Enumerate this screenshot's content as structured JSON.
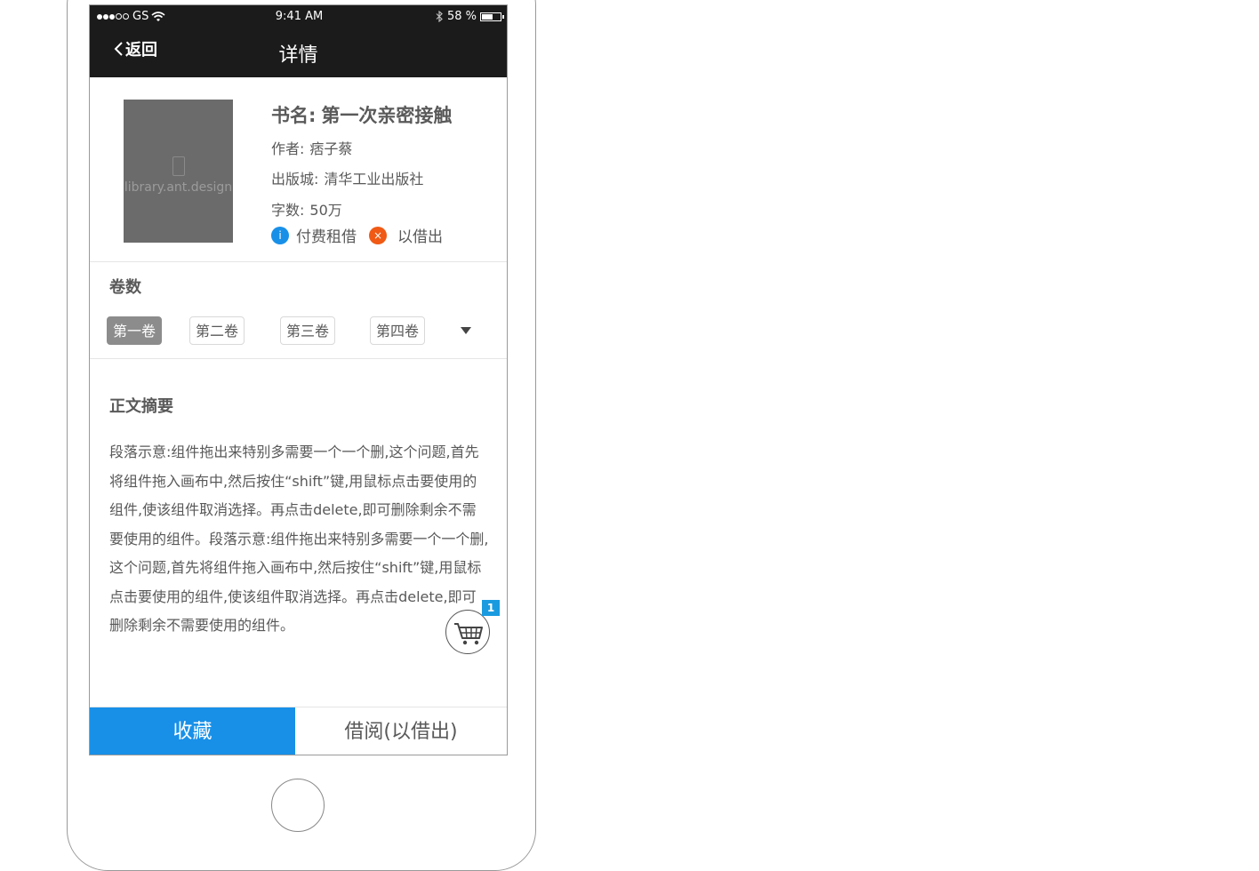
{
  "status_bar": {
    "carrier": "GS",
    "time": "9:41 AM",
    "battery": "58 %",
    "battery_level": 0.58
  },
  "nav": {
    "back": "返回",
    "title": "详情"
  },
  "book": {
    "cover_text": "library.ant.design",
    "title_label": "书名:",
    "title": "第一次亲密接触",
    "author_label": "作者:",
    "author": "痞子蔡",
    "publisher_label": "出版城:",
    "publisher": "清华工业出版社",
    "words_label": "字数:",
    "words": "50万",
    "tags": [
      {
        "icon": "info-icon",
        "glyph": "i",
        "label": "付费租借",
        "color": "#1890e8"
      },
      {
        "icon": "close-circle-icon",
        "glyph": "×",
        "label": "以借出",
        "color": "#f05a14"
      }
    ]
  },
  "volumes": {
    "title": "卷数",
    "items": [
      "第一卷",
      "第二卷",
      "第三卷",
      "第四卷"
    ],
    "selected": "第一卷"
  },
  "summary": {
    "title": "正文摘要",
    "text": "段落示意:组件拖出来特别多需要一个一个删,这个问题,首先将组件拖入画布中,然后按住“shift”键,用鼠标点击要使用的组件,使该组件取消选择。再点击delete,即可删除剩余不需要使用的组件。段落示意:组件拖出来特别多需要一个一个删,这个问题,首先将组件拖入画布中,然后按住“shift”键,用鼠标点击要使用的组件,使该组件取消选择。再点击delete,即可删除剩余不需要使用的组件。"
  },
  "cart": {
    "count": "1"
  },
  "footer": {
    "favorite": "收藏",
    "borrow": "借阅(以借出)"
  },
  "colors": {
    "primary": "#1890e8",
    "header_bg": "#1b1b1b",
    "danger": "#f05a14",
    "badge": "#1a9be0"
  }
}
